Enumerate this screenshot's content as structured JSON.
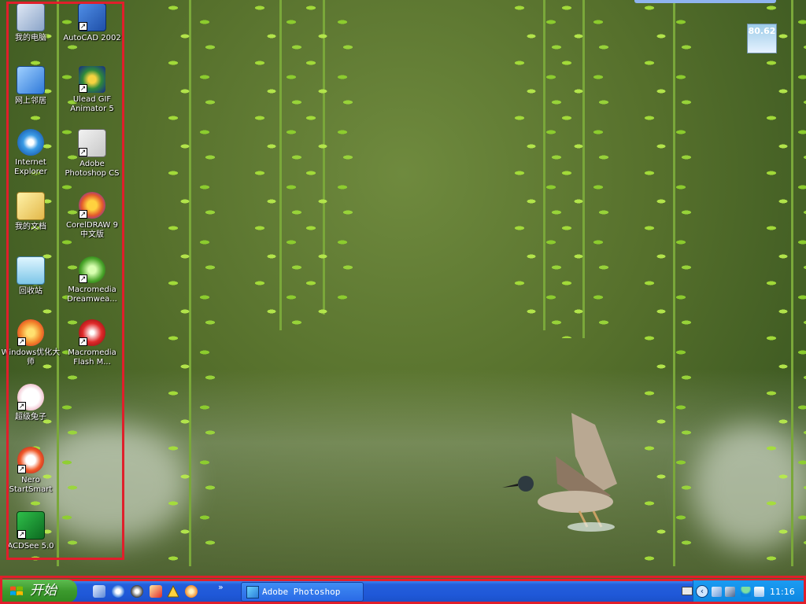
{
  "desktop": {
    "icons": [
      {
        "label": "我的电脑",
        "icon": "my-computer-icon"
      },
      {
        "label": "AutoCAD 2002",
        "icon": "autocad-icon"
      },
      {
        "label": "网上邻居",
        "icon": "network-places-icon"
      },
      {
        "label": "Ulead GIF Animator 5",
        "icon": "ulead-gif-icon"
      },
      {
        "label": "Internet Explorer",
        "icon": "internet-explorer-icon"
      },
      {
        "label": "Adobe Photoshop CS",
        "icon": "photoshop-icon"
      },
      {
        "label": "我的文档",
        "icon": "my-documents-icon"
      },
      {
        "label": "CorelDRAW 9 中文版",
        "icon": "coreldraw-icon"
      },
      {
        "label": "回收站",
        "icon": "recycle-bin-icon"
      },
      {
        "label": "Macromedia Dreamwea...",
        "icon": "dreamweaver-icon"
      },
      {
        "label": "Windows优化大师",
        "icon": "windows-optimizer-icon"
      },
      {
        "label": "Macromedia Flash M...",
        "icon": "flash-icon"
      },
      {
        "label": "超级兔子",
        "icon": "super-rabbit-icon"
      },
      {
        "label": "Nero StartSmart",
        "icon": "nero-icon"
      },
      {
        "label": "ACDSee 5.0",
        "icon": "acdsee-icon"
      }
    ],
    "temperature_widget": "80.62"
  },
  "taskbar": {
    "start_label": "开始",
    "quick_launch": [
      "desktop-icon",
      "settings-icon",
      "globe-icon",
      "media-icon",
      "warning-icon",
      "browser-icon"
    ],
    "chevron": "»",
    "task_button": "Adobe Photoshop",
    "tray_icons": [
      "keyboard-icon",
      "back-arrow-icon",
      "network-icon",
      "monitor-icon",
      "umbrella-icon",
      "antivirus-icon"
    ],
    "clock": "11:16"
  },
  "colors": {
    "highlight_border": "#e01f2b",
    "taskbar_blue": "#245edb",
    "start_green": "#3c9a2d",
    "tray_blue": "#0d86e0"
  }
}
